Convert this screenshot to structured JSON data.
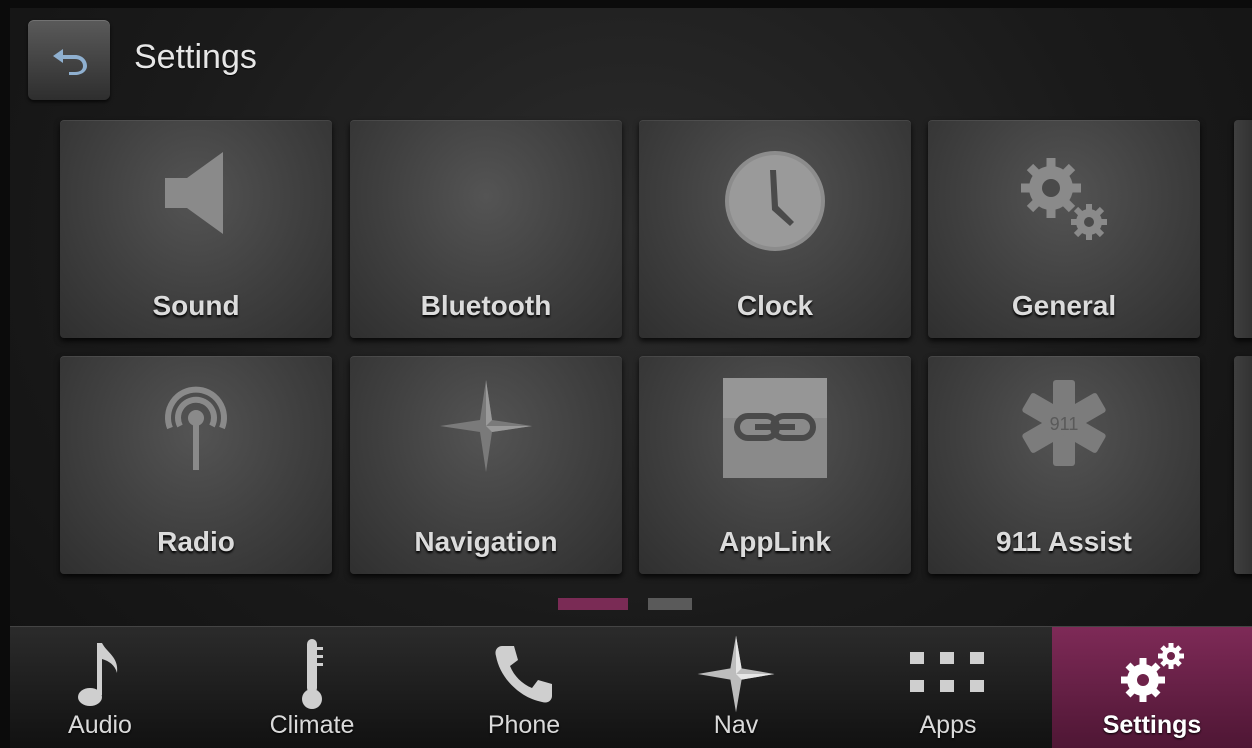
{
  "header": {
    "title": "Settings"
  },
  "tiles": [
    {
      "label": "Sound",
      "icon": "speaker-icon"
    },
    {
      "label": "Bluetooth",
      "icon": "bluetooth-icon"
    },
    {
      "label": "Clock",
      "icon": "clock-icon"
    },
    {
      "label": "General",
      "icon": "gears-icon"
    },
    {
      "label": "Radio",
      "icon": "radio-antenna-icon"
    },
    {
      "label": "Navigation",
      "icon": "compass-star-icon"
    },
    {
      "label": "AppLink",
      "icon": "link-icon"
    },
    {
      "label": "911 Assist",
      "icon": "star-of-life-911-icon",
      "badge": "911"
    }
  ],
  "pager": {
    "pages": 2,
    "current": 1
  },
  "navbar": {
    "items": [
      {
        "label": "Audio",
        "icon": "music-note-icon"
      },
      {
        "label": "Climate",
        "icon": "thermometer-icon"
      },
      {
        "label": "Phone",
        "icon": "phone-handset-icon"
      },
      {
        "label": "Nav",
        "icon": "compass-star-icon"
      },
      {
        "label": "Apps",
        "icon": "grid-icon"
      },
      {
        "label": "Settings",
        "icon": "gears-icon",
        "active": true
      }
    ]
  },
  "colors": {
    "accent": "#7e2a57",
    "tile": "#454545",
    "text": "#dcdcdc"
  }
}
